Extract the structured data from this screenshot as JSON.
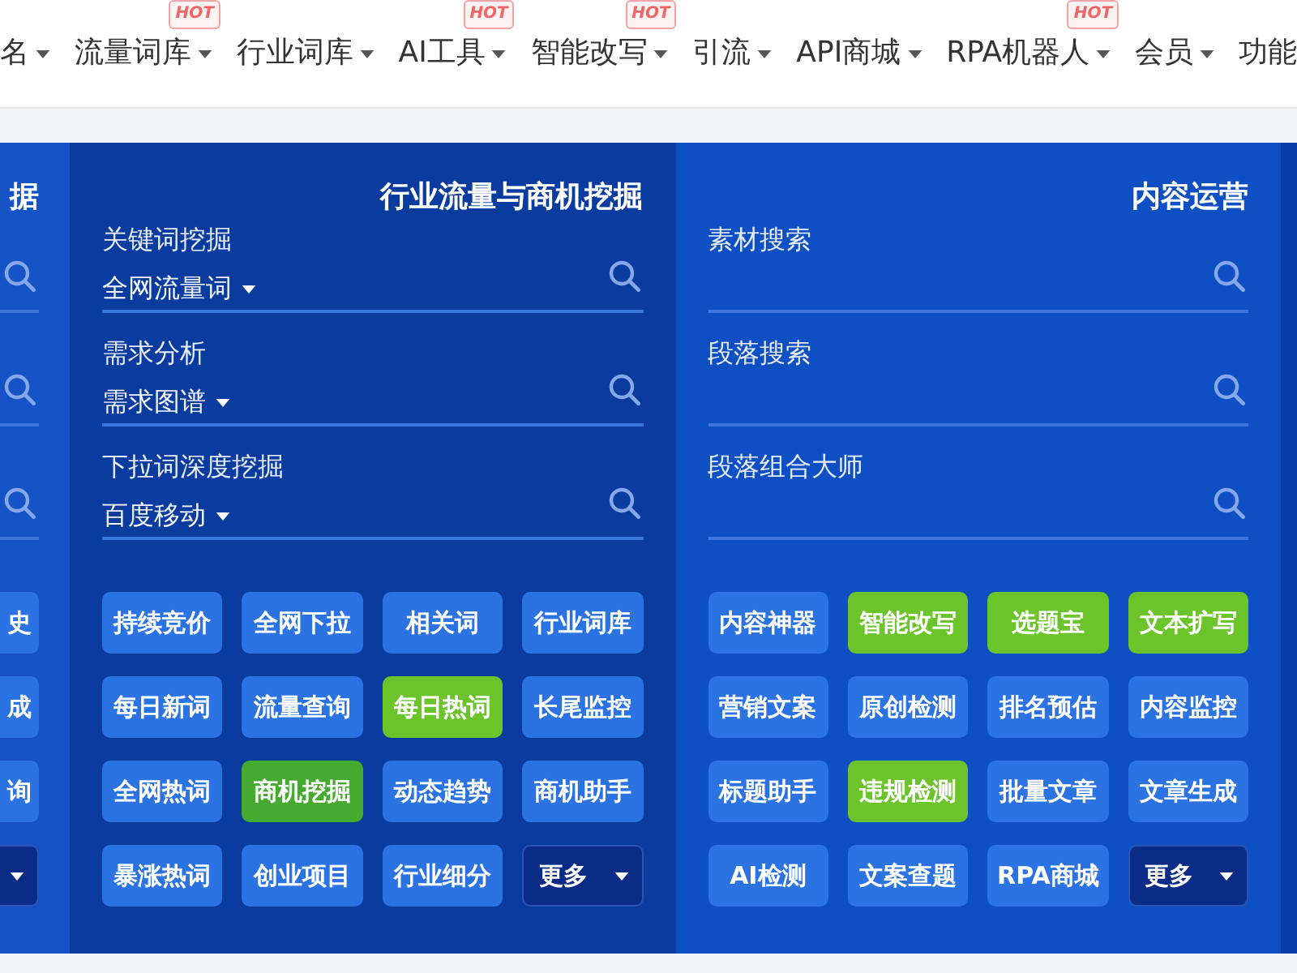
{
  "nav": {
    "items": [
      {
        "label": "名",
        "menu": true
      },
      {
        "label": "流量词库",
        "menu": true,
        "badge": "HOT"
      },
      {
        "label": "行业词库",
        "menu": true
      },
      {
        "label": "AI工具",
        "menu": true,
        "badge": "HOT"
      },
      {
        "label": "智能改写",
        "menu": true,
        "badge": "HOT"
      },
      {
        "label": "引流",
        "menu": true
      },
      {
        "label": "API商城",
        "menu": true
      },
      {
        "label": "RPA机器人",
        "menu": true,
        "badge": "HOT"
      },
      {
        "label": "会员",
        "menu": true
      },
      {
        "label": "功能",
        "menu": false
      }
    ]
  },
  "panels": [
    {
      "kind": "clipped",
      "title": "据",
      "searches": [
        {
          "kind": "search"
        },
        {
          "kind": "search"
        },
        {
          "kind": "search"
        }
      ],
      "buttons": [
        {
          "kind": "button",
          "label": "史",
          "color": "#2b72e3"
        },
        {
          "kind": "button",
          "label": "成",
          "color": "#2b72e3"
        },
        {
          "kind": "button",
          "label": "询",
          "color": "#2b72e3"
        },
        {
          "kind": "dropdown"
        }
      ]
    },
    {
      "kind": "full",
      "title": "行业流量与商机挖掘",
      "searches": [
        {
          "kind": "search",
          "label": "关键词挖掘",
          "select": "全网流量词"
        },
        {
          "kind": "search",
          "label": "需求分析",
          "select": "需求图谱"
        },
        {
          "kind": "search",
          "label": "下拉词深度挖掘",
          "select": "百度移动"
        }
      ],
      "buttons": [
        {
          "kind": "button",
          "label": "持续竞价",
          "color": "#2b72e3"
        },
        {
          "kind": "button",
          "label": "全网下拉",
          "color": "#2b72e3"
        },
        {
          "kind": "button",
          "label": "相关词",
          "color": "#2b72e3"
        },
        {
          "kind": "button",
          "label": "行业词库",
          "color": "#2b72e3"
        },
        {
          "kind": "button",
          "label": "每日新词",
          "color": "#2b72e3"
        },
        {
          "kind": "button",
          "label": "流量查询",
          "color": "#2b72e3"
        },
        {
          "kind": "button",
          "label": "每日热词",
          "color": "#6cc42b"
        },
        {
          "kind": "button",
          "label": "长尾监控",
          "color": "#2b72e3"
        },
        {
          "kind": "button",
          "label": "全网热词",
          "color": "#2b72e3"
        },
        {
          "kind": "button",
          "label": "商机挖掘",
          "color": "#46aa30"
        },
        {
          "kind": "button",
          "label": "动态趋势",
          "color": "#2b72e3"
        },
        {
          "kind": "button",
          "label": "商机助手",
          "color": "#2b72e3"
        },
        {
          "kind": "button",
          "label": "暴涨热词",
          "color": "#2b72e3"
        },
        {
          "kind": "button",
          "label": "创业项目",
          "color": "#2b72e3"
        },
        {
          "kind": "button",
          "label": "行业细分",
          "color": "#2b72e3"
        },
        {
          "kind": "dropdown",
          "label": "更多"
        }
      ]
    },
    {
      "kind": "full",
      "title": "内容运营",
      "searches": [
        {
          "kind": "search",
          "label": "素材搜索"
        },
        {
          "kind": "search",
          "label": "段落搜索"
        },
        {
          "kind": "search",
          "label": "段落组合大师"
        }
      ],
      "buttons": [
        {
          "kind": "button",
          "label": "内容神器",
          "color": "#2b72e3"
        },
        {
          "kind": "button",
          "label": "智能改写",
          "color": "#6cc42b"
        },
        {
          "kind": "button",
          "label": "选题宝",
          "color": "#6cc42b"
        },
        {
          "kind": "button",
          "label": "文本扩写",
          "color": "#6cc42b"
        },
        {
          "kind": "button",
          "label": "营销文案",
          "color": "#2b72e3"
        },
        {
          "kind": "button",
          "label": "原创检测",
          "color": "#2b72e3"
        },
        {
          "kind": "button",
          "label": "排名预估",
          "color": "#2b72e3"
        },
        {
          "kind": "button",
          "label": "内容监控",
          "color": "#2b72e3"
        },
        {
          "kind": "button",
          "label": "标题助手",
          "color": "#2b72e3"
        },
        {
          "kind": "button",
          "label": "违规检测",
          "color": "#6cc42b"
        },
        {
          "kind": "button",
          "label": "批量文章",
          "color": "#2b72e3"
        },
        {
          "kind": "button",
          "label": "文章生成",
          "color": "#2b72e3"
        },
        {
          "kind": "button",
          "label": "AI检测",
          "color": "#2b72e3"
        },
        {
          "kind": "button",
          "label": "文案查题",
          "color": "#2b72e3"
        },
        {
          "kind": "button",
          "label": "RPA商城",
          "color": "#2b72e3"
        },
        {
          "kind": "dropdown",
          "label": "更多"
        }
      ]
    },
    {
      "kind": "edge"
    }
  ]
}
